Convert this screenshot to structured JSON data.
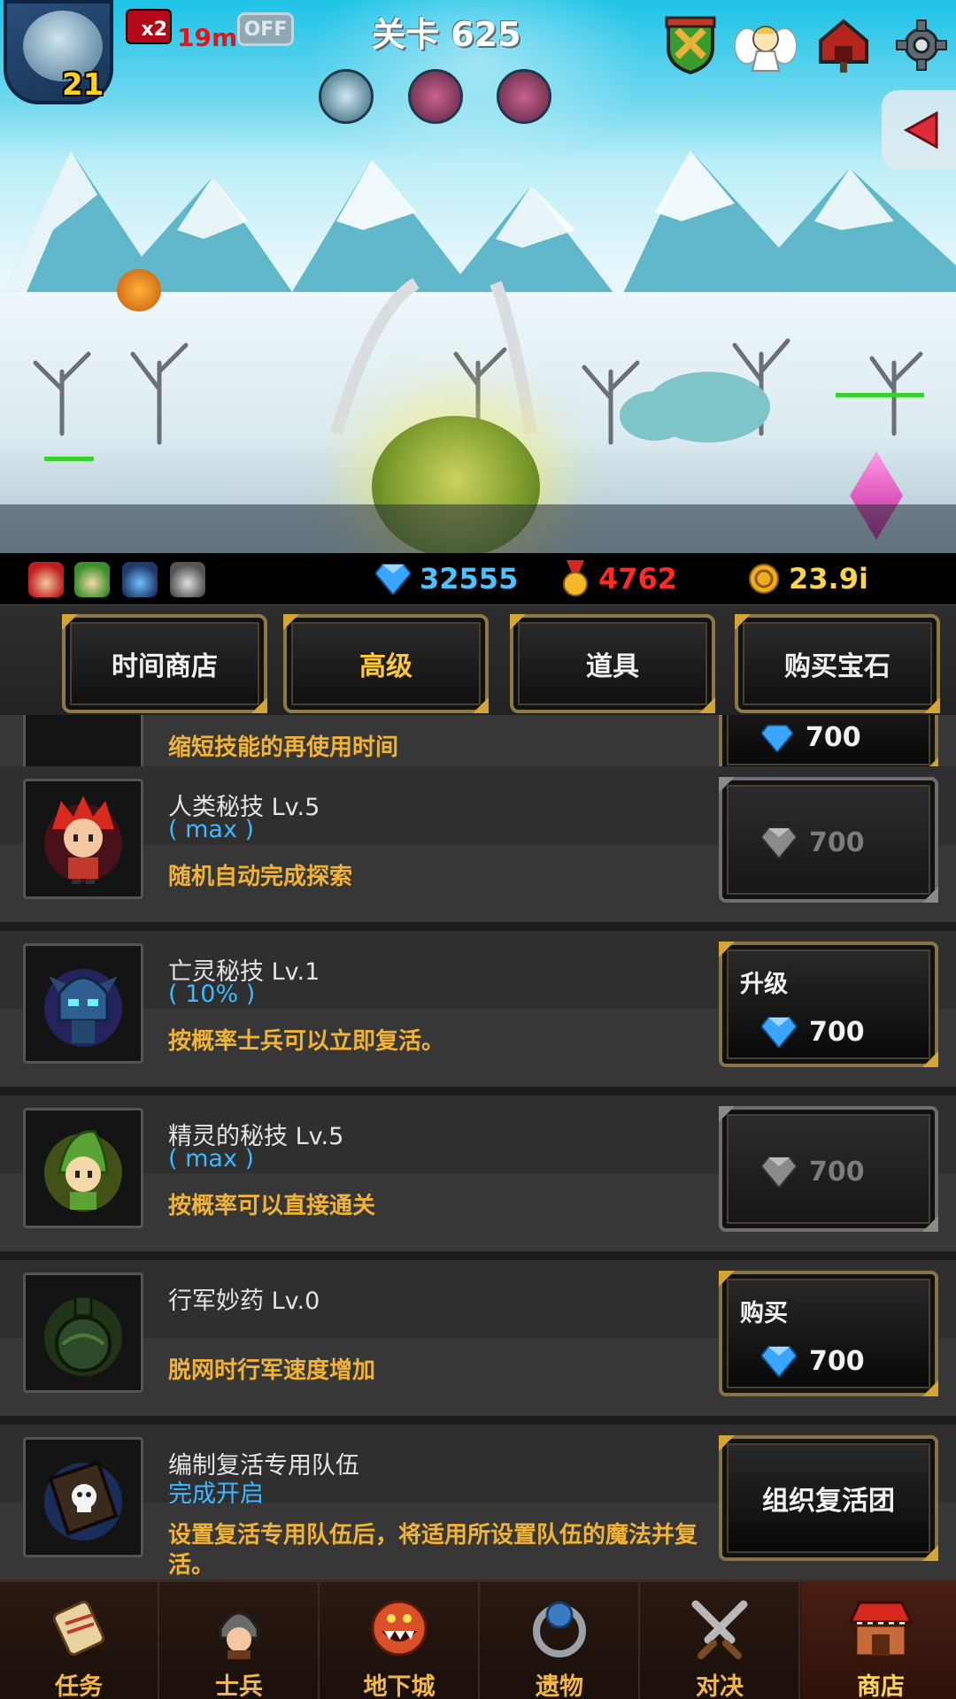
{
  "hud": {
    "hero_level": "21",
    "speed_label": "x2",
    "speed_time": "19m",
    "auto_toggle": "OFF",
    "stage_title": "关卡 625"
  },
  "resources": {
    "gems": "32555",
    "medals": "4762",
    "gold": "23.9i"
  },
  "shop_tabs": [
    {
      "label": "时间商店",
      "active": false
    },
    {
      "label": "高级",
      "active": true
    },
    {
      "label": "道具",
      "active": false
    },
    {
      "label": "购买宝石",
      "active": false
    }
  ],
  "items": {
    "partial": {
      "desc": "缩短技能的再使用时间",
      "price": "700"
    },
    "human": {
      "title": "人类秘技 Lv.5",
      "level": "( max )",
      "desc": "随机自动完成探索",
      "price": "700"
    },
    "undead": {
      "title": "亡灵秘技 Lv.1",
      "level": "( 10% )",
      "desc": "按概率士兵可以立即复活。",
      "button": "升级",
      "price": "700"
    },
    "elf": {
      "title": "精灵的秘技 Lv.5",
      "level": "( max )",
      "desc": "按概率可以直接通关",
      "price": "700"
    },
    "potion": {
      "title": "行军妙药 Lv.0",
      "desc": "脱网时行军速度增加",
      "button": "购买",
      "price": "700"
    },
    "revive": {
      "title": "编制复活专用队伍",
      "level": "完成开启",
      "desc": "设置复活专用队伍后，将适用所设置队伍的魔法并复活。",
      "button": "组织复活团"
    }
  },
  "nav": [
    {
      "label": "任务",
      "icon": "scroll-icon"
    },
    {
      "label": "士兵",
      "icon": "soldier-icon"
    },
    {
      "label": "地下城",
      "icon": "dungeon-icon"
    },
    {
      "label": "遗物",
      "icon": "relic-icon"
    },
    {
      "label": "对决",
      "icon": "swords-icon"
    },
    {
      "label": "商店",
      "icon": "shop-icon",
      "active": true
    }
  ],
  "colors": {
    "gem_blue": "#4cc3ff",
    "medal_red": "#ff2b24",
    "gold_yellow": "#ffd44a",
    "desc_orange": "#f1b336",
    "level_blue": "#3fb8ff",
    "frame_gold": "#d4a535"
  }
}
